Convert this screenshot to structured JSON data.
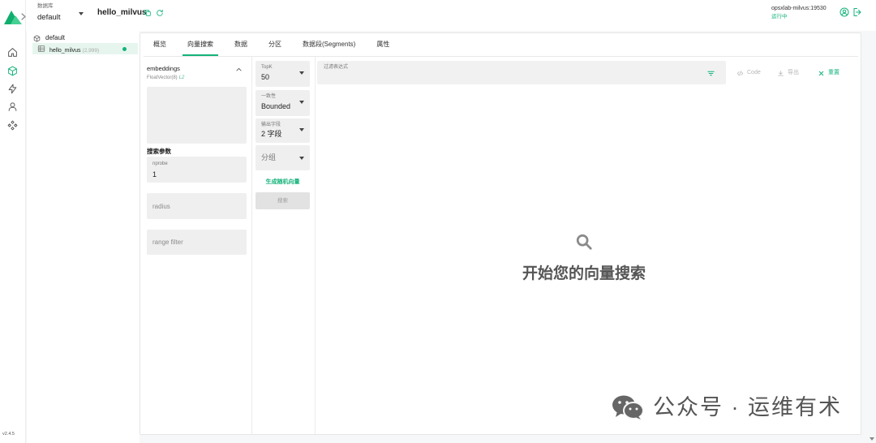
{
  "app": {
    "version": "v2.4.5"
  },
  "colors": {
    "accent": "#14b37a",
    "text": "#222222",
    "muted": "#9a9a9a",
    "field_bg": "#efefef",
    "disabled_bg": "#e2e2e2"
  },
  "nav_rail": {
    "items": [
      {
        "icon": "home-icon",
        "active": false
      },
      {
        "icon": "cube-icon",
        "active": true
      },
      {
        "icon": "lightning-icon",
        "active": false
      },
      {
        "icon": "person-icon",
        "active": false
      },
      {
        "icon": "network-icon",
        "active": false
      }
    ]
  },
  "header": {
    "database_label": "数据库",
    "database_value": "default",
    "collection_name": "hello_milvus",
    "server_address": "opsxlab-milvus:19530",
    "server_status": "运行中"
  },
  "tree": {
    "database": "default",
    "collections": [
      {
        "name": "hello_milvus",
        "row_count": "(2,999)"
      }
    ]
  },
  "tabs": {
    "items": [
      "概览",
      "向量搜索",
      "数据",
      "分区",
      "数据段(Segments)",
      "属性"
    ],
    "active_index": 1
  },
  "search": {
    "vector_field": {
      "name": "embeddings",
      "type": "FloatVector(8)",
      "metric": "L2",
      "value": ""
    },
    "params_title": "搜索参数",
    "nprobe": {
      "label": "nprobe",
      "value": "1"
    },
    "radius": {
      "placeholder": "radius"
    },
    "range_filter": {
      "placeholder": "range filter"
    },
    "topk": {
      "label": "TopK",
      "value": "50"
    },
    "consistency": {
      "label": "一致性",
      "value": "Bounded"
    },
    "output_fields": {
      "label": "输出字段",
      "value": "2 字段"
    },
    "group_by": {
      "placeholder": "分组"
    },
    "generate_random_label": "生成随机向量",
    "search_button_label": "搜索",
    "filter": {
      "label": "过滤表达式",
      "value": ""
    },
    "toolbar": {
      "code_label": "Code",
      "export_label": "导出",
      "reset_label": "重置"
    },
    "empty_state_text": "开始您的向量搜索"
  },
  "watermark": {
    "text": "公众号 · 运维有术"
  }
}
